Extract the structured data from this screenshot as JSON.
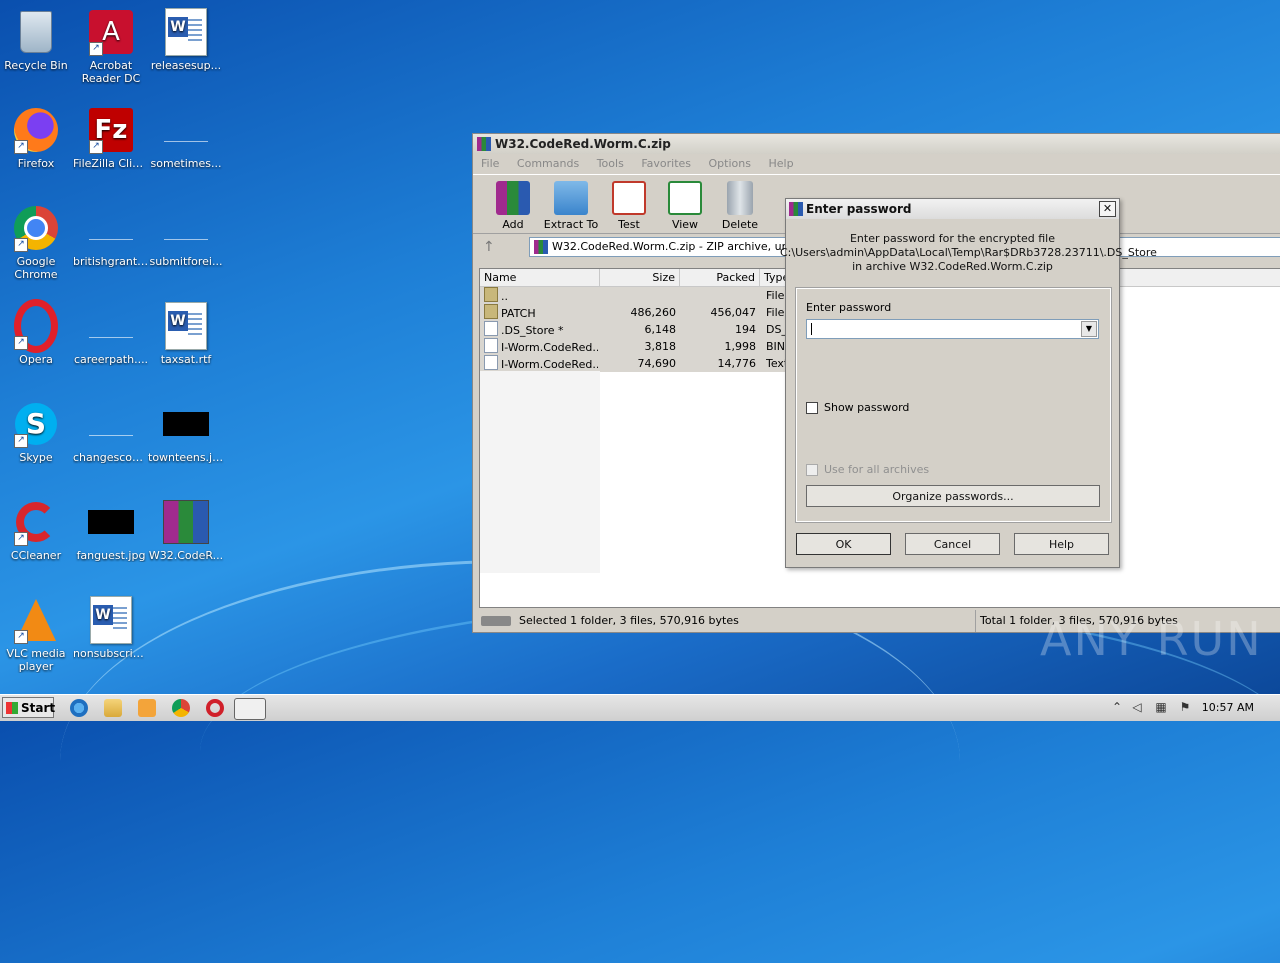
{
  "desktop": {
    "icons": [
      {
        "label": "Recycle Bin"
      },
      {
        "label": "Acrobat Reader DC"
      },
      {
        "label": "releasesup..."
      },
      {
        "label": "Firefox"
      },
      {
        "label": "FileZilla Client"
      },
      {
        "label": "sometimes..."
      },
      {
        "label": "Google Chrome"
      },
      {
        "label": "britishgrant...."
      },
      {
        "label": "submitforei..."
      },
      {
        "label": "Opera"
      },
      {
        "label": "careerpath...."
      },
      {
        "label": "taxsat.rtf"
      },
      {
        "label": "Skype"
      },
      {
        "label": "changescou..."
      },
      {
        "label": "townteens.jpg"
      },
      {
        "label": "CCleaner"
      },
      {
        "label": "fanguest.jpg"
      },
      {
        "label": "W32.CodeR..."
      },
      {
        "label": "VLC media player"
      },
      {
        "label": "nonsubscrib..."
      }
    ]
  },
  "winrar": {
    "title": "W32.CodeRed.Worm.C.zip",
    "menu": [
      "File",
      "Commands",
      "Tools",
      "Favorites",
      "Options",
      "Help"
    ],
    "toolbar": [
      "Add",
      "Extract To",
      "Test",
      "View",
      "Delete"
    ],
    "address": "W32.CodeRed.Worm.C.zip - ZIP archive, unpacked size 570,916 bytes",
    "columns": {
      "name": "Name",
      "size": "Size",
      "packed": "Packed",
      "type": "Type"
    },
    "rows": [
      {
        "name": "..",
        "size": "",
        "packed": "",
        "type": "File folder"
      },
      {
        "name": "PATCH",
        "size": "486,260",
        "packed": "456,047",
        "type": "File folder"
      },
      {
        "name": ".DS_Store *",
        "size": "6,148",
        "packed": "194",
        "type": "DS_Store File"
      },
      {
        "name": "I-Worm.CodeRed...",
        "size": "3,818",
        "packed": "1,998",
        "type": "BIN File"
      },
      {
        "name": "I-Worm.CodeRed...",
        "size": "74,690",
        "packed": "14,776",
        "type": "Text Document"
      }
    ],
    "status_left": "Selected 1 folder, 3 files, 570,916 bytes",
    "status_right": "Total 1 folder, 3 files, 570,916 bytes"
  },
  "dialog": {
    "title": "Enter password",
    "msg1": "Enter password for the encrypted file",
    "msg2": "C:\\Users\\admin\\AppData\\Local\\Temp\\Rar$DRb3728.23711\\.DS_Store",
    "msg3": "in archive W32.CodeRed.Worm.C.zip",
    "field_label": "Enter password",
    "field_value": "",
    "show_password": "Show password",
    "use_for_all": "Use for all archives",
    "organize": "Organize passwords...",
    "ok": "OK",
    "cancel": "Cancel",
    "help": "Help"
  },
  "taskbar": {
    "start": "Start",
    "clock": "10:57 AM"
  },
  "watermark": "ANY RUN"
}
